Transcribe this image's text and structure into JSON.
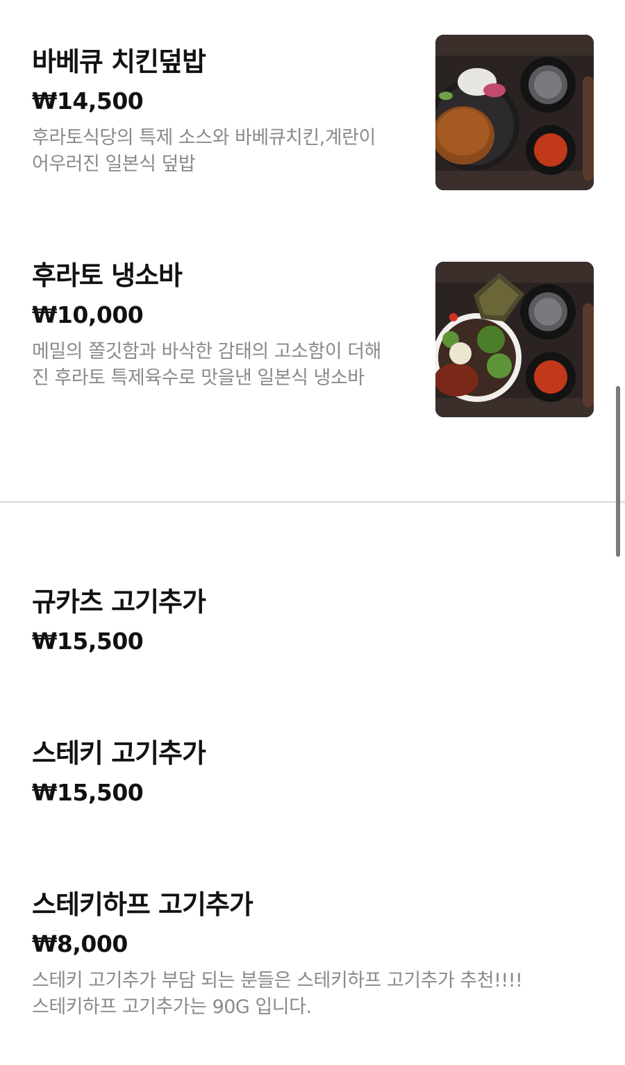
{
  "menu": {
    "items": [
      {
        "name": "바베큐 치킨덮밥",
        "price": "₩14,500",
        "description": "후라토식당의 특제 소스와 바베큐치킨,계란이 어우러진 일본식 덮밥"
      },
      {
        "name": "후라토 냉소바",
        "price": "₩10,000",
        "description": "메밀의 쫄깃함과 바삭한 감태의 고소함이 더해진 후라토 특제육수로 맛을낸 일본식 냉소바"
      },
      {
        "name": "규카츠 고기추가",
        "price": "₩15,500"
      },
      {
        "name": "스테키 고기추가",
        "price": "₩15,500"
      },
      {
        "name": "스테키하프 고기추가",
        "price": "₩8,000",
        "description_line1": "스테키 고기추가 부담 되는 분들은 스테키하프 고기추가 추천!!!!",
        "description_line2": "스테키하프 고기추가는 90G 입니다."
      }
    ]
  },
  "colors": {
    "text": "#111111",
    "muted": "#8a8a8a",
    "divider": "#d9d9d9",
    "scrollbar": "#7a7a7a"
  },
  "icons": {
    "item_0_thumbnail": "bbq-chicken-rice-bowl-photo",
    "item_1_thumbnail": "cold-soba-photo"
  }
}
